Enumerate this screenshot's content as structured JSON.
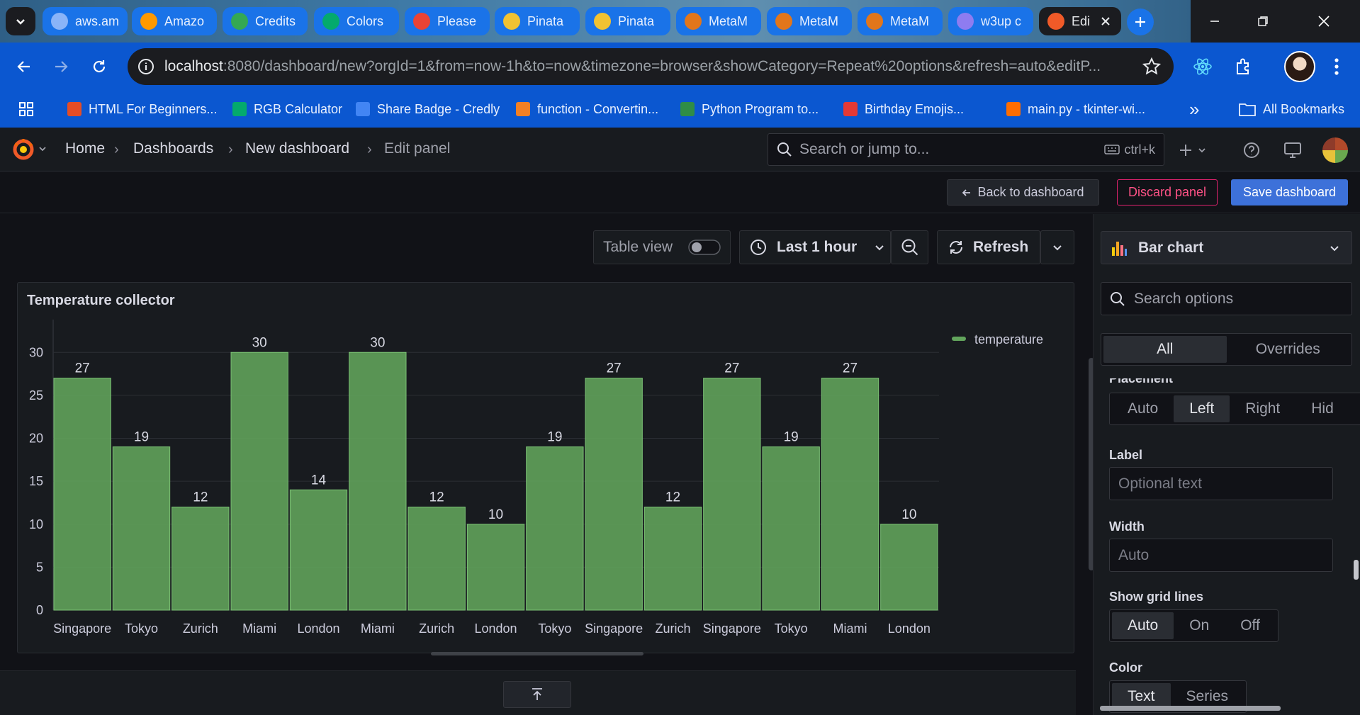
{
  "browser": {
    "tabs": [
      {
        "label": "aws.am",
        "icon": "globe-icon",
        "color": "#8ab4f8"
      },
      {
        "label": "Amazo",
        "icon": "amazon-icon",
        "color": "#ff9900"
      },
      {
        "label": "Credits",
        "icon": "credits-icon",
        "color": "#34a853"
      },
      {
        "label": "Colors",
        "icon": "w3-icon",
        "color": "#04aa6d"
      },
      {
        "label": "Please",
        "icon": "gmail-icon",
        "color": "#ea4335"
      },
      {
        "label": "Pinata",
        "icon": "pinata-icon",
        "color": "#f1c232"
      },
      {
        "label": "Pinata",
        "icon": "pinata-icon",
        "color": "#f1c232"
      },
      {
        "label": "MetaM",
        "icon": "metamask-icon",
        "color": "#e2761b"
      },
      {
        "label": "MetaM",
        "icon": "metamask-icon",
        "color": "#e2761b"
      },
      {
        "label": "MetaM",
        "icon": "metamask-icon",
        "color": "#e2761b"
      },
      {
        "label": "w3up c",
        "icon": "w3up-icon",
        "color": "#8e7cf0"
      },
      {
        "label": "Edi",
        "icon": "grafana-icon",
        "color": "#f05a28",
        "active": true
      }
    ],
    "url_host": "localhost",
    "url_rest": ":8080/dashboard/new?orgId=1&from=now-1h&to=now&timezone=browser&showCategory=Repeat%20options&refresh=auto&editP...",
    "bookmarks": [
      {
        "label": "HTML For Beginners...",
        "color": "#e44d26"
      },
      {
        "label": "RGB Calculator",
        "color": "#04aa6d"
      },
      {
        "label": "Share Badge - Credly",
        "color": "#4285f4"
      },
      {
        "label": "function - Convertin...",
        "color": "#f48024"
      },
      {
        "label": "Python Program to...",
        "color": "#2f8d46"
      },
      {
        "label": "Birthday Emojis...",
        "color": "#e53935"
      },
      {
        "label": "main.py - tkinter-wi...",
        "color": "#ff6d00"
      }
    ],
    "bookmarks_overflow": "»",
    "all_bookmarks": "All Bookmarks"
  },
  "grafana": {
    "breadcrumbs": [
      "Home",
      "Dashboards",
      "New dashboard",
      "Edit panel"
    ],
    "search_placeholder": "Search or jump to...",
    "search_shortcut": "ctrl+k",
    "back_label": "Back to dashboard",
    "discard_label": "Discard panel",
    "save_label": "Save dashboard",
    "table_view_label": "Table view",
    "time_range": "Last 1 hour",
    "refresh_label": "Refresh"
  },
  "panel": {
    "title": "Temperature collector"
  },
  "chart_data": {
    "type": "bar",
    "title": "Temperature collector",
    "categories": [
      "Singapore",
      "Tokyo",
      "Zurich",
      "Miami",
      "London",
      "Miami",
      "Zurich",
      "London",
      "Tokyo",
      "Singapore",
      "Zurich",
      "Singapore",
      "Tokyo",
      "Miami",
      "London"
    ],
    "series": [
      {
        "name": "temperature",
        "values": [
          27,
          19,
          12,
          30,
          14,
          30,
          12,
          10,
          19,
          27,
          12,
          27,
          19,
          27,
          10
        ],
        "color": "#62a55c"
      }
    ],
    "yticks": [
      0,
      5,
      10,
      15,
      20,
      25,
      30
    ],
    "ylim": [
      0,
      32
    ],
    "grid": true,
    "legend": "top-right",
    "show_values": true
  },
  "options": {
    "viz_type": "Bar chart",
    "search_placeholder": "Search options",
    "tabs": [
      "All",
      "Overrides"
    ],
    "placement_label": "Placement",
    "placement_options": [
      "Auto",
      "Left",
      "Right",
      "Hid"
    ],
    "label_label": "Label",
    "label_placeholder": "Optional text",
    "width_label": "Width",
    "width_placeholder": "Auto",
    "grid_label": "Show grid lines",
    "grid_options": [
      "Auto",
      "On",
      "Off"
    ],
    "color_label": "Color",
    "color_options": [
      "Text",
      "Series"
    ]
  }
}
